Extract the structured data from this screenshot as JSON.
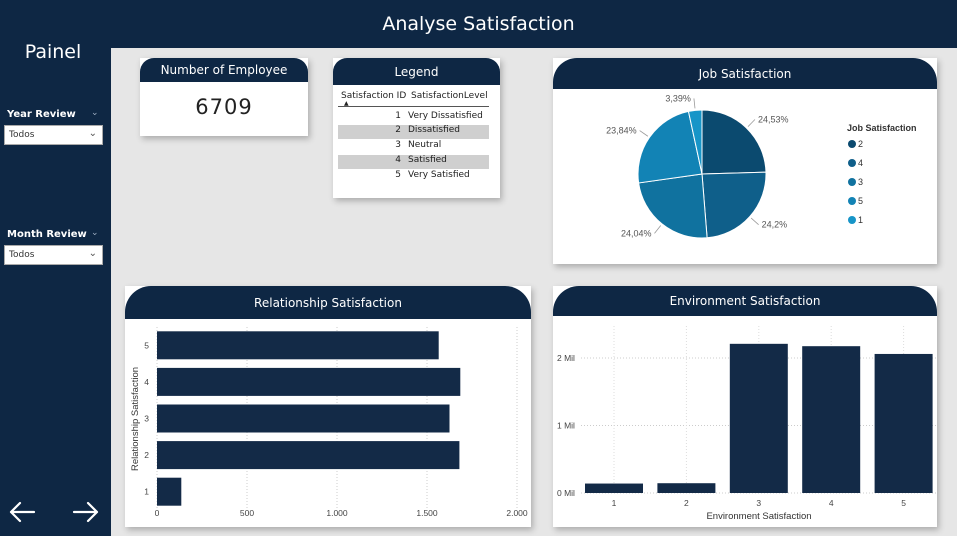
{
  "header": {
    "title": "Analyse Satisfaction"
  },
  "sidebar": {
    "title": "Painel",
    "filters": [
      {
        "label": "Year Review",
        "value": "Todos"
      },
      {
        "label": "Month Review",
        "value": "Todos"
      }
    ]
  },
  "kpi": {
    "title": "Number of Employee",
    "value": "6709"
  },
  "legend_table": {
    "title": "Legend",
    "columns": [
      "Satisfaction ID",
      "SatisfactionLevel"
    ],
    "rows": [
      {
        "id": "1",
        "level": "Very Dissatisfied"
      },
      {
        "id": "2",
        "level": "Dissatisfied"
      },
      {
        "id": "3",
        "level": "Neutral"
      },
      {
        "id": "4",
        "level": "Satisfied"
      },
      {
        "id": "5",
        "level": "Very Satisfied"
      }
    ]
  },
  "cards": {
    "job": "Job Satisfaction",
    "relationship": "Relationship Satisfaction",
    "environment": "Environment Satisfaction"
  },
  "chart_data": [
    {
      "type": "pie",
      "title": "Job Satisfaction",
      "legend_title": "Job Satisfaction",
      "legend_position": "right",
      "slices": [
        {
          "name": "2",
          "value": 24.53,
          "label": "24,53%",
          "color": "#0b4a6f"
        },
        {
          "name": "4",
          "value": 24.2,
          "label": "24,2%",
          "color": "#0f5f8a"
        },
        {
          "name": "3",
          "value": 24.04,
          "label": "24,04%",
          "color": "#10729f"
        },
        {
          "name": "5",
          "value": 23.84,
          "label": "23,84%",
          "color": "#1283b5"
        },
        {
          "name": "1",
          "value": 3.39,
          "label": "3,39%",
          "color": "#1795c8"
        }
      ]
    },
    {
      "type": "bar",
      "orientation": "horizontal",
      "title": "Relationship Satisfaction",
      "ylabel": "Relationship Satisfaction",
      "categories": [
        "5",
        "4",
        "3",
        "2",
        "1"
      ],
      "values": [
        1565,
        1685,
        1625,
        1680,
        135
      ],
      "xlim": [
        0,
        2000
      ],
      "xticks": [
        0,
        500,
        1000,
        1500,
        2000
      ],
      "xtick_labels": [
        "0",
        "500",
        "1.000",
        "1.500",
        "2.000"
      ],
      "grid": true,
      "color": "#132a47"
    },
    {
      "type": "bar",
      "title": "Environment Satisfaction",
      "xlabel": "Environment Satisfaction",
      "categories": [
        "1",
        "2",
        "3",
        "4",
        "5"
      ],
      "values": [
        140,
        145,
        2210,
        2175,
        2060
      ],
      "ylim": [
        0,
        2000
      ],
      "yticks": [
        0,
        1000,
        2000
      ],
      "ytick_labels": [
        "0 Mil",
        "1 Mil",
        "2 Mil"
      ],
      "grid": true,
      "color": "#132a47"
    }
  ]
}
